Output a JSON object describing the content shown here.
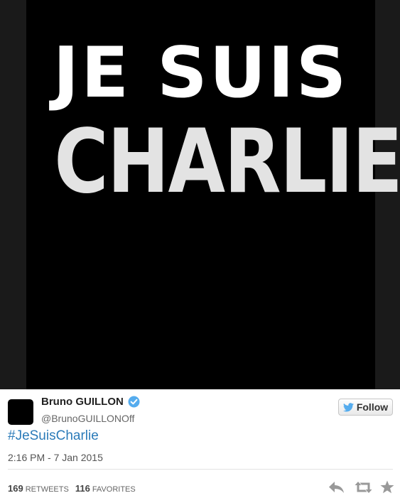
{
  "media": {
    "line1": "JE SUIS",
    "line2": "CHARLIE"
  },
  "tweet": {
    "author_name": "Bruno GUILLON",
    "author_handle": "@BrunoGUILLONOff",
    "follow_label": "Follow",
    "text": "#JeSuisCharlie",
    "timestamp": "2:16 PM - 7 Jan 2015",
    "retweets_count": "169",
    "retweets_label": "RETWEETS",
    "favorites_count": "116",
    "favorites_label": "FAVORITES"
  },
  "icons": {
    "verified": "verified-badge-icon",
    "follow_bird": "twitter-bird-icon",
    "reply": "reply-icon",
    "retweet": "retweet-icon",
    "favorite": "star-icon"
  },
  "colors": {
    "link": "#2b7bb9",
    "verified": "#55acee",
    "action_icon": "#999999"
  }
}
